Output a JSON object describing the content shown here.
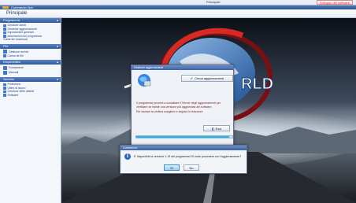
{
  "top_strip": {
    "item_label": "Principale",
    "red_button_label": "Sviluppo del software"
  },
  "app": {
    "title": "Commercio Net",
    "header_title": "Principale"
  },
  "sidebar": {
    "sections": [
      {
        "title": "Programma",
        "items": [
          "Gestione utenti",
          "Gestione aggiornamenti",
          "Impostazioni generali",
          "Informazioni sul programma",
          "Guida del download"
        ]
      },
      {
        "title": "File",
        "items": [
          "Gestione archivi",
          "Carica da file"
        ]
      },
      {
        "title": "Disponibilità",
        "items": [
          "Fondamenti",
          "Manuali"
        ]
      },
      {
        "title": "Servizio",
        "items": [
          "Protezione",
          "Ultimi di lavoro",
          "Gestione delle attività",
          "Software"
        ]
      }
    ]
  },
  "background": {
    "logo_text": "RLD"
  },
  "update_dialog": {
    "title": "Gestione aggiornamenti",
    "check_button": "Cerca aggiornamenti",
    "message_line1": "Il programma proverà a contattare il Server degli aggiornamenti per verificare se esiste una versione più aggiornata del software.",
    "message_line2": "Per iniziare la verifica scegliere e seguire le istruzioni",
    "close_button": "Esci",
    "progress": 0.97
  },
  "confirm_dialog": {
    "title": "Commercio",
    "message": "E' disponibile la versione 1.19 del programma! Si vuole procedere con l'aggiornamento?",
    "yes_button": "Sì",
    "no_button": "No"
  },
  "colors": {
    "accent": "#2e5a9e",
    "progress": "#18b9e8",
    "message_red": "#7a1a1a"
  }
}
